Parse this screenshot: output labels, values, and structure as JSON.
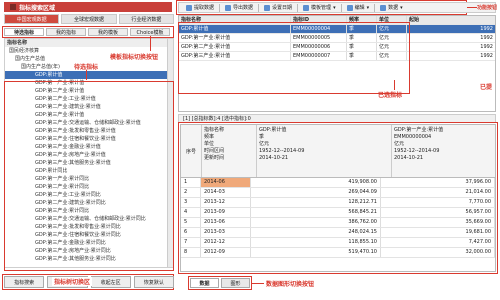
{
  "left": {
    "title": "指标搜索区域",
    "db_tabs": [
      "中国宏观数据",
      "全球宏观数据",
      "行业经济数据"
    ],
    "sub_tabs": [
      "待选指标",
      "我的指标",
      "我的模板",
      "Choice模板"
    ],
    "tree_header": "指标名称",
    "tree": [
      "国民经济核算",
      "国内生产总值",
      "国内生产总值(年)",
      "GDP:累计值",
      "GDP:第一产业:累计值",
      "GDP:第二产业:累计值",
      "GDP:第二产业:工业:累计值",
      "GDP:第二产业:建筑业:累计值",
      "GDP:第三产业:累计值",
      "GDP:第三产业:交通运输、仓储和邮政业:累计值",
      "GDP:第三产业:批发和零售业:累计值",
      "GDP:第三产业:住宿和餐饮业:累计值",
      "GDP:第三产业:金融业:累计值",
      "GDP:第三产业:房地产业:累计值",
      "GDP:第三产业:其他服务业:累计值",
      "GDP:累计同比",
      "GDP:第一产业:累计同比",
      "GDP:第二产业:累计同比",
      "GDP:第二产业:工业:累计同比",
      "GDP:第二产业:建筑业:累计同比",
      "GDP:第三产业:累计同比",
      "GDP:第三产业:交通运输、仓储和邮政业:累计同比",
      "GDP:第三产业:批发和零售业:累计同比",
      "GDP:第三产业:住宿和餐饮业:累计同比",
      "GDP:第三产业:金融业:累计同比",
      "GDP:第三产业:房地产业:累计同比",
      "GDP:第三产业:其他服务业:累计同比"
    ],
    "bottom_buttons": [
      "指标搜索",
      "指标树",
      "收起左区",
      "恢复默认"
    ],
    "annotations": {
      "pending": "待选指标",
      "template": "模板指标切换按钮",
      "search": "指标树切换区"
    }
  },
  "toolbar": {
    "buttons": [
      "提取数据",
      "导出数据",
      "设置日期",
      "模板管理",
      "编辑",
      "数据"
    ],
    "annotation": "功能按钮"
  },
  "top_grid": {
    "columns": [
      "指标名称",
      "指标ID",
      "频率",
      "单位",
      "起始"
    ],
    "rows": [
      [
        "GDP:累计值",
        "EMM00000004",
        "季",
        "亿元",
        "1992"
      ],
      [
        "GDP:第一产业:累计值",
        "EMM00000005",
        "季",
        "亿元",
        "1992"
      ],
      [
        "GDP:第二产业:累计值",
        "EMM00000006",
        "季",
        "亿元",
        "1992"
      ],
      [
        "GDP:第三产业:累计值",
        "EMM00000007",
        "季",
        "亿元",
        "1992"
      ]
    ],
    "annotation_selected": "已选指标",
    "annotation_added": "已提"
  },
  "status": "[1] [总指标数]:4 [选中指标]:0",
  "bottom_grid": {
    "seq_header": "序号",
    "attr_labels": [
      "指标名称",
      "频率",
      "单位",
      "时间区间",
      "更新时间"
    ],
    "series": [
      {
        "name": "GDP:累计值",
        "freq": "季",
        "unit": "亿元",
        "range": "1952-12--2014-09",
        "updated": "2014-10-21"
      },
      {
        "name": "GDP:第一产业:累计值",
        "freq": "EMM00000004",
        "unit": "亿元",
        "range": "1952-12--2014-09",
        "updated": "2014-10-21"
      }
    ],
    "rows": [
      {
        "date": "2014-06",
        "v1": "419,908.00",
        "v2": "37,996.00"
      },
      {
        "date": "2014-03",
        "v1": "269,044.09",
        "v2": "21,014.00"
      },
      {
        "date": "2013-12",
        "v1": "128,212.71",
        "v2": "7,770.00"
      },
      {
        "date": "2013-09",
        "v1": "568,845.21",
        "v2": "56,957.00"
      },
      {
        "date": "2013-06",
        "v1": "386,762.00",
        "v2": "35,669.00"
      },
      {
        "date": "2013-03",
        "v1": "248,024.15",
        "v2": "19,681.00"
      },
      {
        "date": "2012-12",
        "v1": "118,855.10",
        "v2": "7,427.00"
      },
      {
        "date": "2012-09",
        "v1": "519,470.10",
        "v2": "32,000.00"
      }
    ]
  },
  "bottom_tabs": [
    "数据",
    "图形"
  ],
  "bottom_annotation": "数据图形切换按钮"
}
